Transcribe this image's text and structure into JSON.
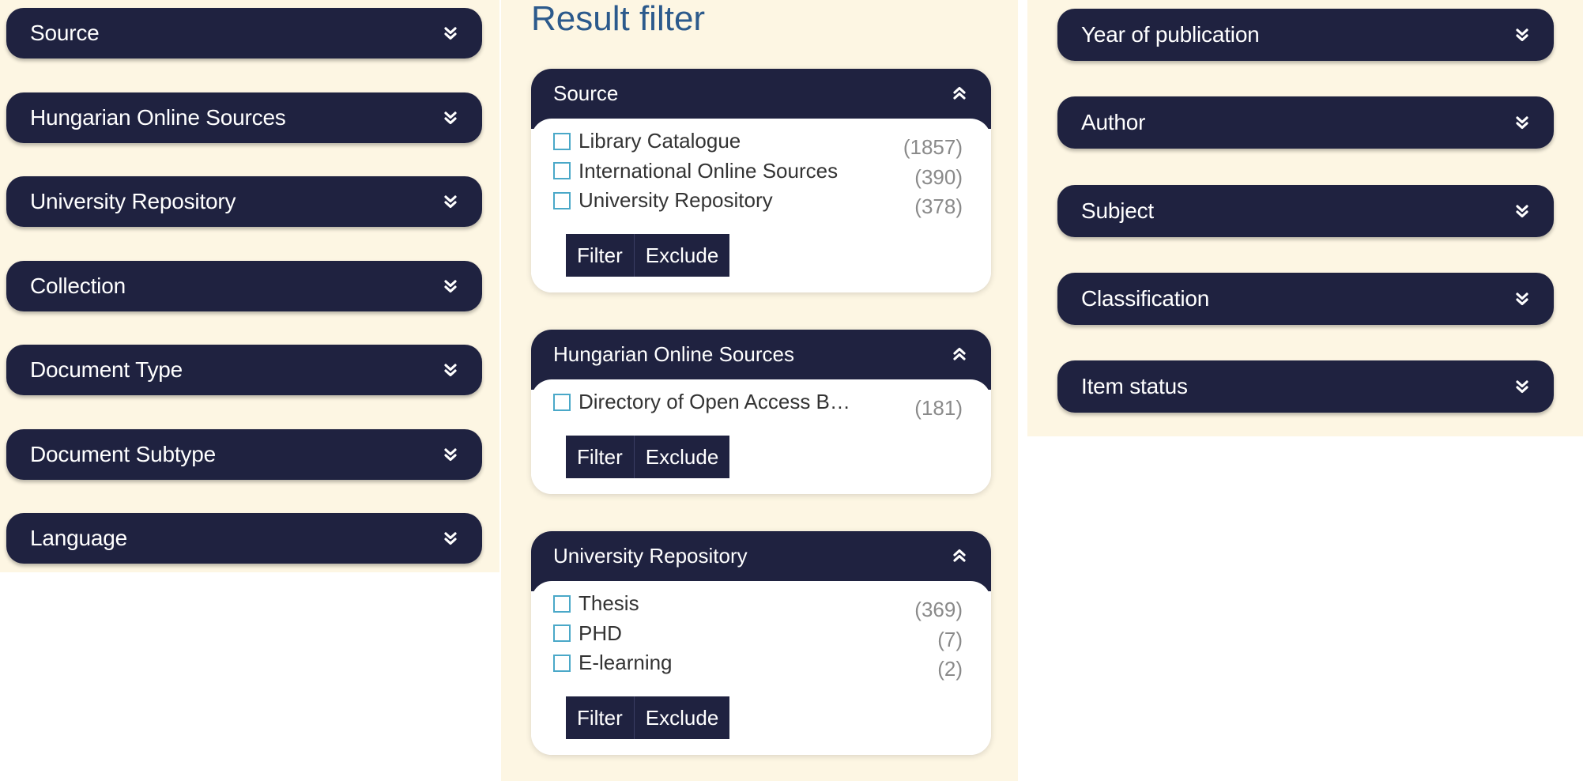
{
  "left_facets": [
    {
      "label": "Source"
    },
    {
      "label": "Hungarian Online Sources"
    },
    {
      "label": "University Repository"
    },
    {
      "label": "Collection"
    },
    {
      "label": "Document Type"
    },
    {
      "label": "Document Subtype"
    },
    {
      "label": "Language"
    }
  ],
  "result_filter": {
    "title": "Result filter",
    "panels": [
      {
        "title": "Source",
        "options": [
          {
            "label": "Library Catalogue",
            "count": "(1857)"
          },
          {
            "label": "International Online Sources",
            "count": "(390)"
          },
          {
            "label": "University Repository",
            "count": "(378)"
          }
        ],
        "filter_label": "Filter",
        "exclude_label": "Exclude"
      },
      {
        "title": "Hungarian Online Sources",
        "options": [
          {
            "label": "Directory of Open Access B…",
            "count": "(181)"
          }
        ],
        "filter_label": "Filter",
        "exclude_label": "Exclude"
      },
      {
        "title": "University Repository",
        "options": [
          {
            "label": "Thesis",
            "count": "(369)"
          },
          {
            "label": "PHD",
            "count": "(7)"
          },
          {
            "label": "E-learning",
            "count": "(2)"
          }
        ],
        "filter_label": "Filter",
        "exclude_label": "Exclude"
      }
    ]
  },
  "right_facets": [
    {
      "label": "Year of publication"
    },
    {
      "label": "Author"
    },
    {
      "label": "Subject"
    },
    {
      "label": "Classification"
    },
    {
      "label": "Item status"
    }
  ],
  "icons": {
    "collapsed": "chevron-double-down-icon",
    "expanded": "chevron-double-up-icon"
  },
  "colors": {
    "header_bg": "#1f2240",
    "panel_bg": "#fdf6e3",
    "title": "#2c5a8c",
    "checkbox_border": "#4aa8c8",
    "count_text": "#8a8a8a"
  }
}
